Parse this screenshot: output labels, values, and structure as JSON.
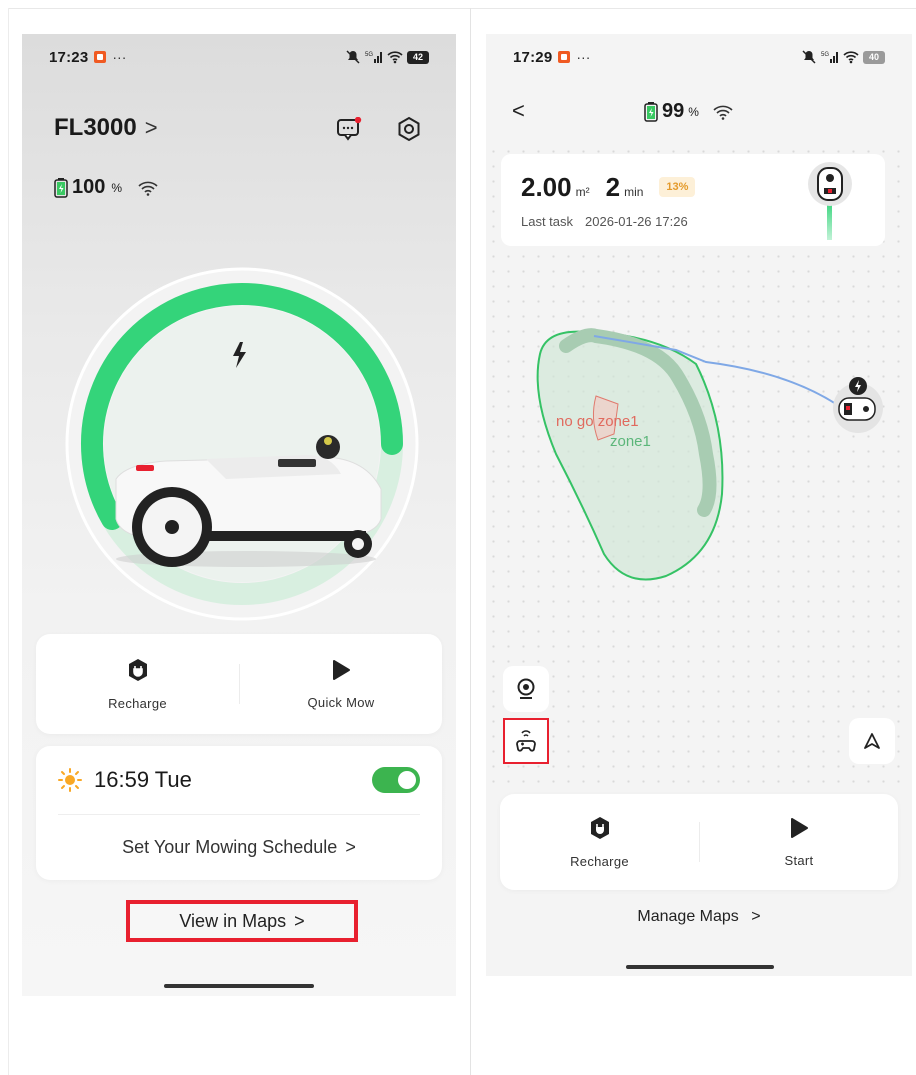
{
  "left_screen": {
    "status": {
      "time": "17:23",
      "battery": "42",
      "more": "···"
    },
    "device_name": "FL3000",
    "device_chevron": ">",
    "battery_percent": "100",
    "battery_unit": "%",
    "charge_progress": 0.7,
    "actions": [
      {
        "label": "Recharge",
        "icon": "plug-icon"
      },
      {
        "label": "Quick Mow",
        "icon": "play-icon"
      }
    ],
    "schedule": {
      "time": "16:59 Tue",
      "enabled": true,
      "link": "Set Your Mowing Schedule",
      "link_chevron": ">"
    },
    "view_maps": {
      "label": "View in Maps",
      "chevron": ">"
    }
  },
  "right_screen": {
    "status": {
      "time": "17:29",
      "battery": "40",
      "more": "···"
    },
    "back_label": "<",
    "battery_percent": "99",
    "battery_unit": "%",
    "task": {
      "area_value": "2.00",
      "area_unit": "m²",
      "time_value": "2",
      "time_unit": "min",
      "progress_badge": "13%",
      "last_task_label": "Last task",
      "last_task_time": "2026-01-26 17:26"
    },
    "map": {
      "zone_label": "zone1",
      "nogo_label": "no go zone1"
    },
    "actions": [
      {
        "label": "Recharge",
        "icon": "plug-icon"
      },
      {
        "label": "Start",
        "icon": "play-icon"
      }
    ],
    "manage_maps": {
      "label": "Manage Maps",
      "chevron": ">"
    }
  },
  "colors": {
    "accent_green": "#3cb44f",
    "gauge_green": "#34d47a",
    "highlight_red": "#e8202f",
    "badge_orange": "#e49a2a",
    "path_blue": "#7fa8e6"
  }
}
